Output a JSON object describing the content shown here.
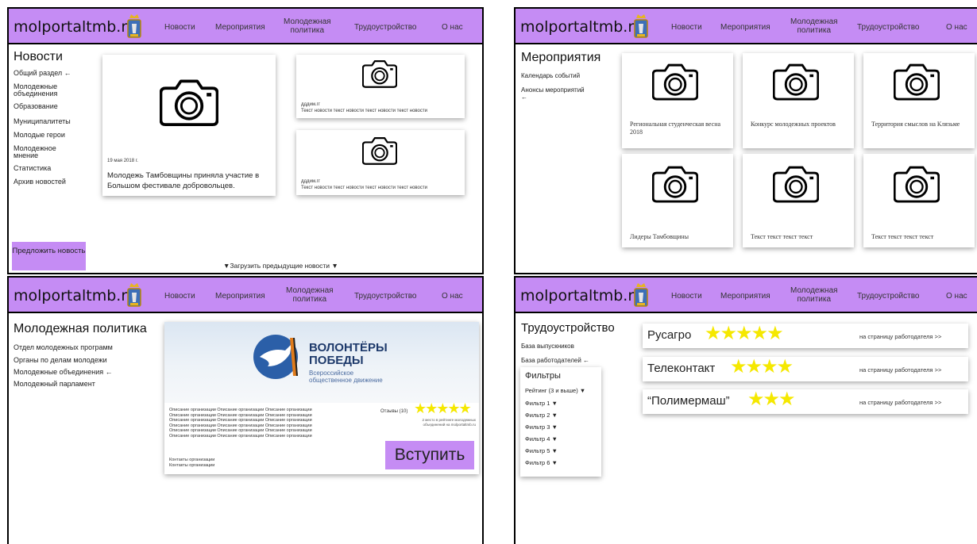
{
  "site": {
    "logo": "molportaltmb.ru"
  },
  "nav": {
    "news": "Новости",
    "events": "Мероприятия",
    "youth_1": "Молодежная",
    "youth_2": "политика",
    "jobs": "Трудоустройство",
    "about": "О нас"
  },
  "news_page": {
    "title": "Новости",
    "sidebar": [
      "Общий раздел ←",
      "Молодежные объединения",
      "Образование",
      "Муниципалитеты",
      "Молодые герои",
      "Молодежное мнение",
      "Статистика",
      "Архив новостей"
    ],
    "main_card": {
      "date": "19 мая 2018 г.",
      "headline": "Молодежь Тамбовщины приняла участие в Большом фестивале добровольцев."
    },
    "small_cards": [
      {
        "label": "дддим.гг",
        "text": "Текст новости текст новости текст новости текст новости"
      },
      {
        "label": "дддим.гг",
        "text": "Текст новости текст новости текст новости текст новости"
      }
    ],
    "suggest_button": "Предложить новость",
    "load_more": "▼Загрузить предыдущие новости ▼"
  },
  "events_page": {
    "title": "Мероприятия",
    "sidebar": [
      "Календарь событий",
      "Анонсы мероприятий ←"
    ],
    "cards": [
      "Региональная студенческая весна 2018",
      "Конкурс молодежных проектов",
      "Территория смыслов на Клязьме",
      "Лидеры Тамбовщины",
      "Текст текст текст текст",
      "Текст текст текст текст"
    ]
  },
  "youth_page": {
    "title": "Молодежная политика",
    "sidebar": [
      "Отдел молодежных программ",
      "Органы по делам молодежи",
      "Молодежные объединения ←",
      "Молодежный парламент"
    ],
    "org": {
      "name_1": "ВОЛОНТЁРЫ",
      "name_2": "ПОБЕДЫ",
      "sub_1": "Всероссийское",
      "sub_2": "общественное движение",
      "description": [
        "Описание организации Описание организации Описание организации",
        "Описание организации Описание организации Описание организации",
        "Описание организации Описание организации Описание организации",
        "Описание организации Описание организации Описание организации",
        "Описание организации Описание организации Описание организации",
        "Описание организации Описание организации Описание организации"
      ],
      "contacts": [
        "Контакты организации",
        "Контакты организации"
      ],
      "reviews": "Отзывы (10)",
      "rank_1": "2 место в рейтинге молодежных",
      "rank_2": "объединений на molportaltmb.ru",
      "join_button": "Вступить",
      "rating": 5
    }
  },
  "jobs_page": {
    "title": "Трудоустройство",
    "sidebar": [
      "База выпускников",
      "База работодателей ←"
    ],
    "filters": {
      "title": "Фильтры",
      "items": [
        "Рейтинг (3 и выше) ▼",
        "Фильтр 1 ▼",
        "Фильтр 2 ▼",
        "Фильтр 3 ▼",
        "Фильтр 4 ▼",
        "Фильтр 5 ▼",
        "Фильтр 6 ▼"
      ]
    },
    "employers": [
      {
        "name": "Русагро",
        "rating": 5,
        "link": "на страницу работодателя >>"
      },
      {
        "name": "Телеконтакт",
        "rating": 4,
        "link": "на страницу работодателя >>"
      },
      {
        "name": "“Полимермаш”",
        "rating": 3,
        "link": "на страницу работодателя >>"
      }
    ],
    "star_color": "#f5e800"
  }
}
